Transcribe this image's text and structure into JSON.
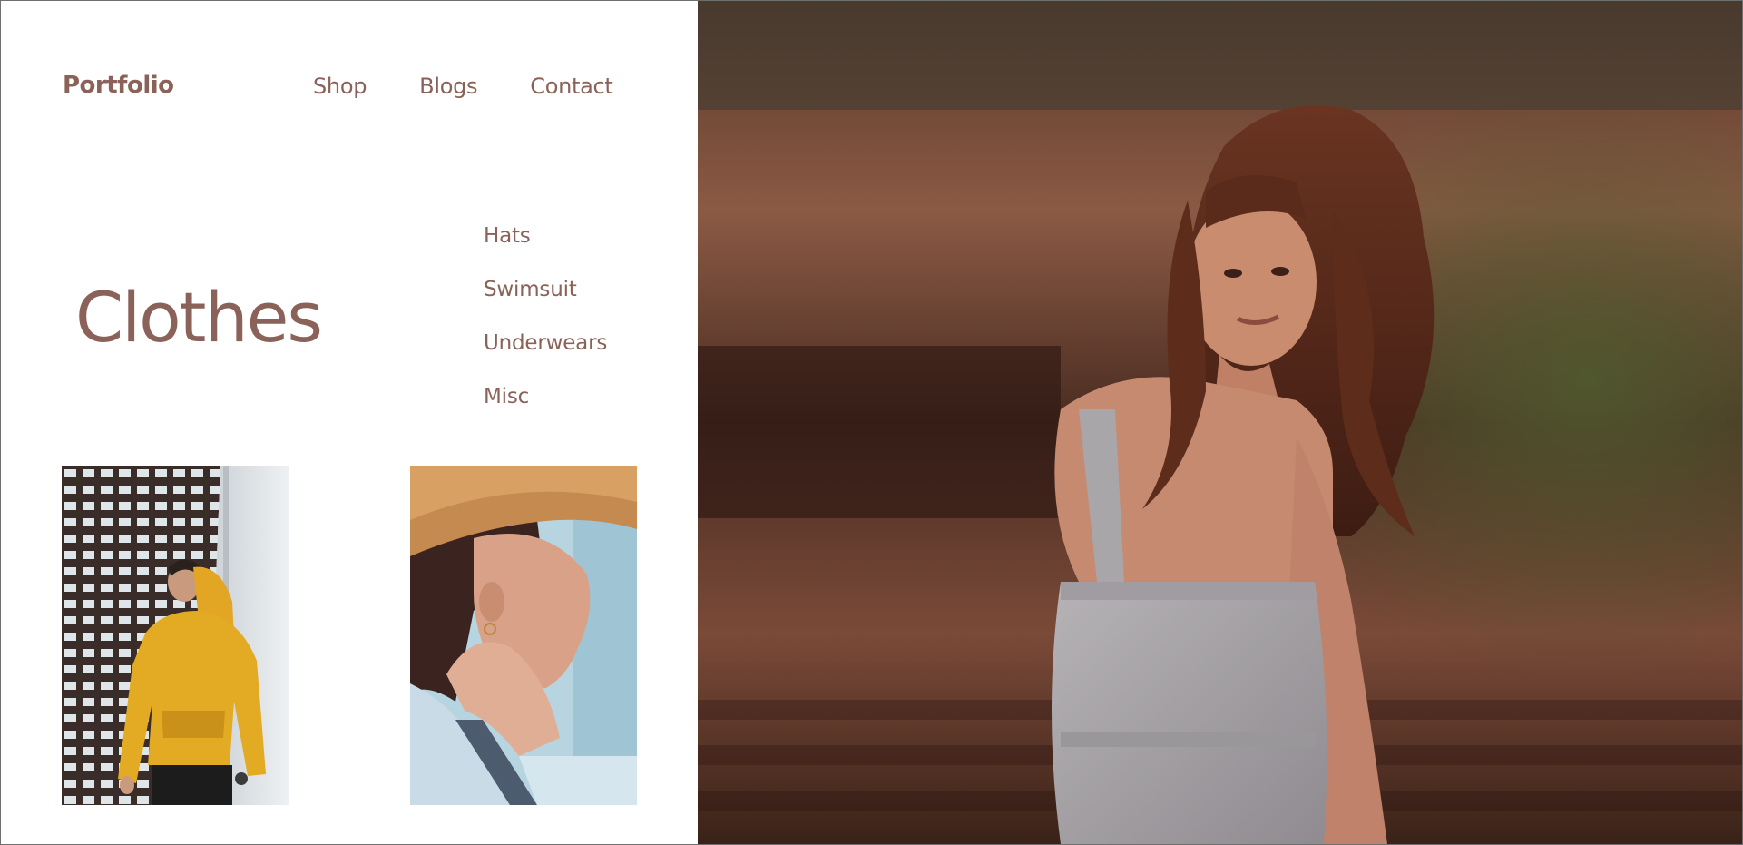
{
  "header": {
    "brand": "Portfolio",
    "nav": [
      "Shop",
      "Blogs",
      "Contact"
    ]
  },
  "hero": {
    "title": "Clothes"
  },
  "categories": [
    "Hats",
    "Swimsuit",
    "Underwears",
    "Misc"
  ],
  "images": {
    "thumb_1": "photo-man-yellow-hoodie",
    "thumb_2": "photo-woman-straw-hat",
    "hero": "photo-woman-gray-dress"
  },
  "colors": {
    "accent": "#8a6259",
    "background": "#ffffff",
    "border": "#6f6f6f"
  }
}
